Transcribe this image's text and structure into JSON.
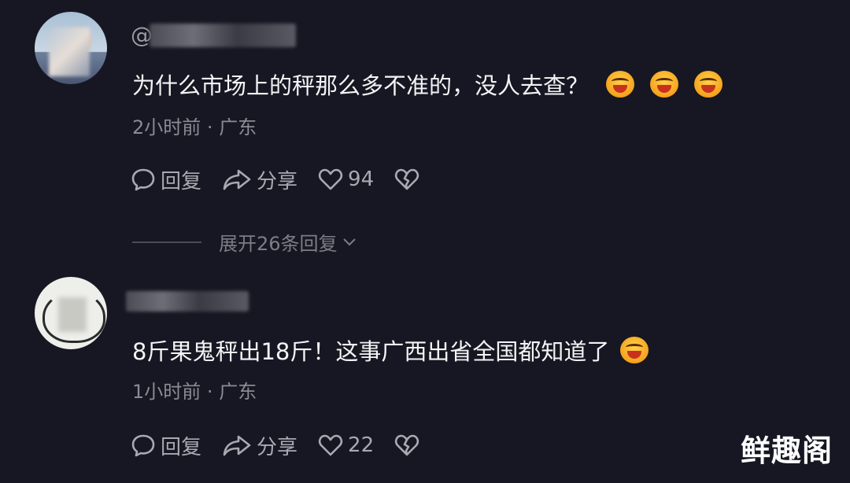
{
  "comments": [
    {
      "username": "@",
      "text": "为什么市场上的秤那么多不准的，没人去查？",
      "emoji_count": 3,
      "emoji": "laughing-emoji",
      "time": "2小时前",
      "separator": "·",
      "location": "广东",
      "reply_label": "回复",
      "share_label": "分享",
      "likes": "94",
      "expand_label": "展开26条回复"
    },
    {
      "username": "",
      "text": "8斤果鬼秤出18斤！这事广西出省全国都知道了",
      "emoji_count": 1,
      "emoji": "laughing-emoji",
      "time": "1小时前",
      "separator": "·",
      "location": "广东",
      "reply_label": "回复",
      "share_label": "分享",
      "likes": "22"
    }
  ],
  "watermark": "鲜趣阁",
  "colors": {
    "background": "#161722",
    "text": "#f4f4f6",
    "meta": "#8a8b93",
    "action": "#a8a9b1"
  }
}
